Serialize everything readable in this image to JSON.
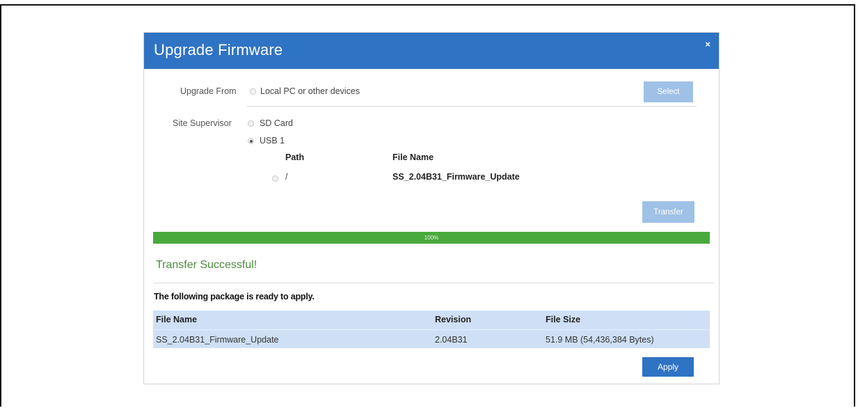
{
  "dialog": {
    "title": "Upgrade Firmware",
    "close_label": "×"
  },
  "upgrade_from": {
    "label": "Upgrade From",
    "local_option": "Local PC or other devices",
    "select_button": "Select"
  },
  "site_supervisor": {
    "label": "Site Supervisor",
    "sd_option": "SD Card",
    "usb_option": "USB 1",
    "selected": "USB 1",
    "file_table": {
      "headers": {
        "path": "Path",
        "file_name": "File Name"
      },
      "rows": [
        {
          "path": "/",
          "file_name": "SS_2.04B31_Firmware_Update"
        }
      ]
    },
    "transfer_button": "Transfer"
  },
  "progress": {
    "value": 100,
    "text": "100%",
    "color": "#4aa93c"
  },
  "status": {
    "message": "Transfer Successful!"
  },
  "package": {
    "intro": "The following package is ready to apply.",
    "headers": {
      "file_name": "File Name",
      "revision": "Revision",
      "file_size": "File Size"
    },
    "rows": [
      {
        "file_name": "SS_2.04B31_Firmware_Update",
        "revision": "2.04B31",
        "file_size": "51.9 MB (54,436,384 Bytes)"
      }
    ]
  },
  "apply_button": "Apply",
  "colors": {
    "header": "#2f73c4",
    "accent_green": "#4c8b3e",
    "table_bg": "#cfe0f6"
  }
}
